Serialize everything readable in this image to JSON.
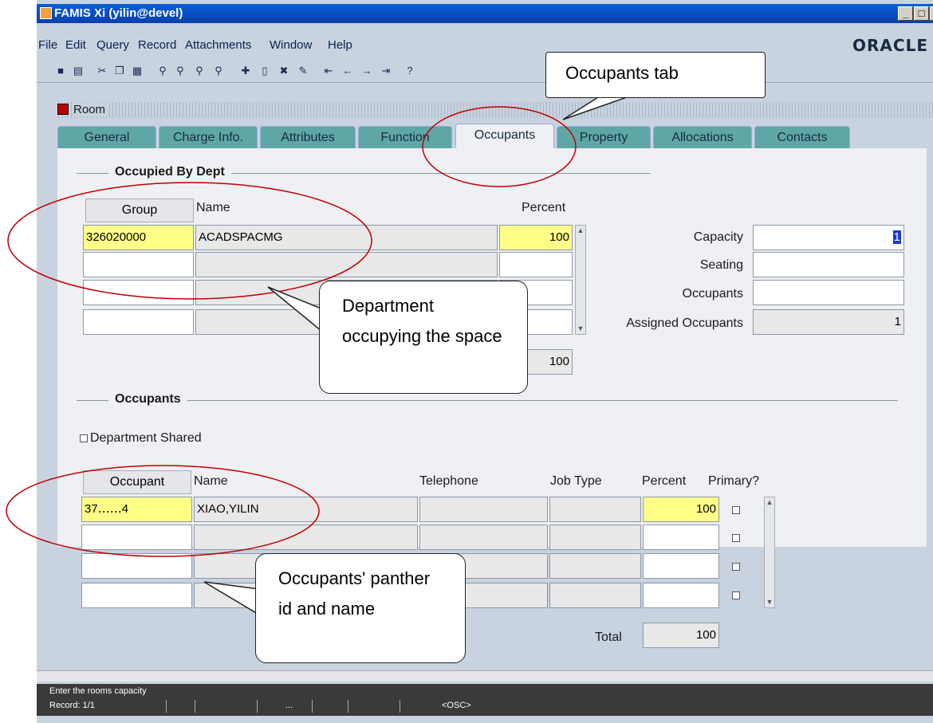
{
  "window": {
    "title": "FAMIS Xi (yilin@devel)",
    "controls": [
      "_",
      "□",
      "×"
    ]
  },
  "menu": {
    "items": [
      "File",
      "Edit",
      "Query",
      "Record",
      "Attachments",
      "Window",
      "Help"
    ],
    "brand": "ORACLE"
  },
  "form": {
    "title": "Room",
    "tabs": [
      "General",
      "Charge Info.",
      "Attributes",
      "Function",
      "Occupants",
      "Property",
      "Allocations",
      "Contacts"
    ],
    "active_tab": "Occupants"
  },
  "occupied_by_dept": {
    "section_title": "Occupied By Dept",
    "headers": {
      "group": "Group",
      "name": "Name",
      "percent": "Percent"
    },
    "rows": [
      {
        "group": "326020000",
        "name": "ACADSPACMG",
        "percent": "100"
      },
      {
        "group": "",
        "name": "",
        "percent": ""
      },
      {
        "group": "",
        "name": "",
        "percent": ""
      },
      {
        "group": "",
        "name": "",
        "percent": ""
      }
    ],
    "total": "100"
  },
  "room_fields": {
    "capacity_label": "Capacity",
    "capacity_value": "1",
    "seating_label": "Seating",
    "seating_value": "",
    "occupants_label": "Occupants",
    "occupants_value": "",
    "assigned_label": "Assigned Occupants",
    "assigned_value": "1"
  },
  "occupants": {
    "section_title": "Occupants",
    "dept_shared_label": "Department Shared",
    "headers": {
      "occupant": "Occupant",
      "name": "Name",
      "telephone": "Telephone",
      "job_type": "Job Type",
      "percent": "Percent",
      "primary": "Primary?"
    },
    "rows": [
      {
        "occupant": "37‥‥‥4",
        "name": "XIAO,YILIN",
        "telephone": "",
        "job_type": "",
        "percent": "100"
      },
      {
        "occupant": "",
        "name": "",
        "telephone": "",
        "job_type": "",
        "percent": ""
      },
      {
        "occupant": "",
        "name": "",
        "telephone": "",
        "job_type": "",
        "percent": ""
      },
      {
        "occupant": "",
        "name": "",
        "telephone": "",
        "job_type": "",
        "percent": ""
      }
    ],
    "total_label": "Total",
    "total_value": "100"
  },
  "status": {
    "message": "Enter the rooms capacity",
    "record": "Record: 1/1",
    "dots": "...",
    "osc": "<OSC>"
  },
  "callouts": {
    "tab": "Occupants tab",
    "dept": "Department occupying the space",
    "occupants": "Occupants' panther id and name"
  },
  "colors": {
    "highlight_yellow": "#ffff88",
    "tab_teal": "#5fa7a7",
    "annotation_red": "#c00000"
  }
}
